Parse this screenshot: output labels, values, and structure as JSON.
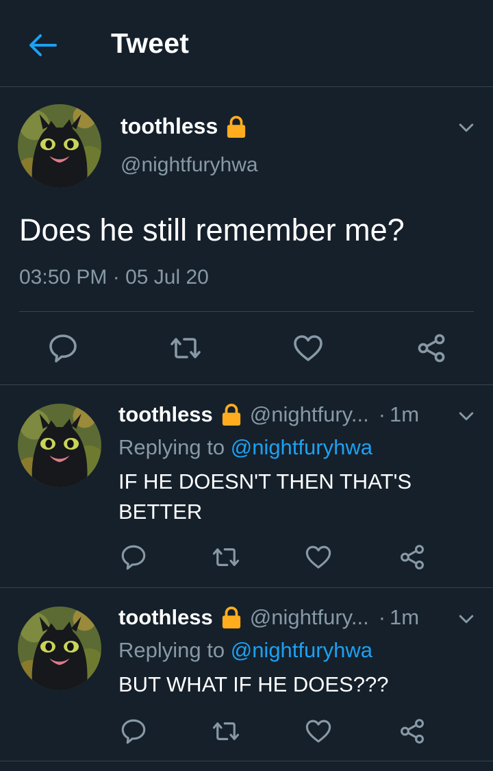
{
  "header": {
    "title": "Tweet"
  },
  "main_tweet": {
    "display_name": "toothless",
    "handle": "@nightfuryhwa",
    "text": "Does he still remember me?",
    "timestamp": "03:50 PM · 05 Jul 20"
  },
  "replies": [
    {
      "display_name": "toothless",
      "handle": "@nightfury...",
      "separator": "·",
      "time": "1m",
      "replying_prefix": "Replying to ",
      "replying_to": "@nightfuryhwa",
      "text": "IF HE DOESN'T THEN THAT'S BETTER"
    },
    {
      "display_name": "toothless",
      "handle": "@nightfury...",
      "separator": "·",
      "time": "1m",
      "replying_prefix": "Replying to ",
      "replying_to": "@nightfuryhwa",
      "text": "BUT WHAT IF HE DOES???"
    }
  ],
  "icons": {
    "back": "arrow-left-icon",
    "lock": "lock-icon",
    "caret": "chevron-down-icon",
    "reply": "reply-icon",
    "retweet": "retweet-icon",
    "like": "heart-icon",
    "share": "share-icon"
  },
  "colors": {
    "background": "#15202b",
    "accent": "#1da1f2",
    "secondary_text": "#8899a6",
    "divider": "#38444d",
    "lock": "#ffad1f"
  }
}
